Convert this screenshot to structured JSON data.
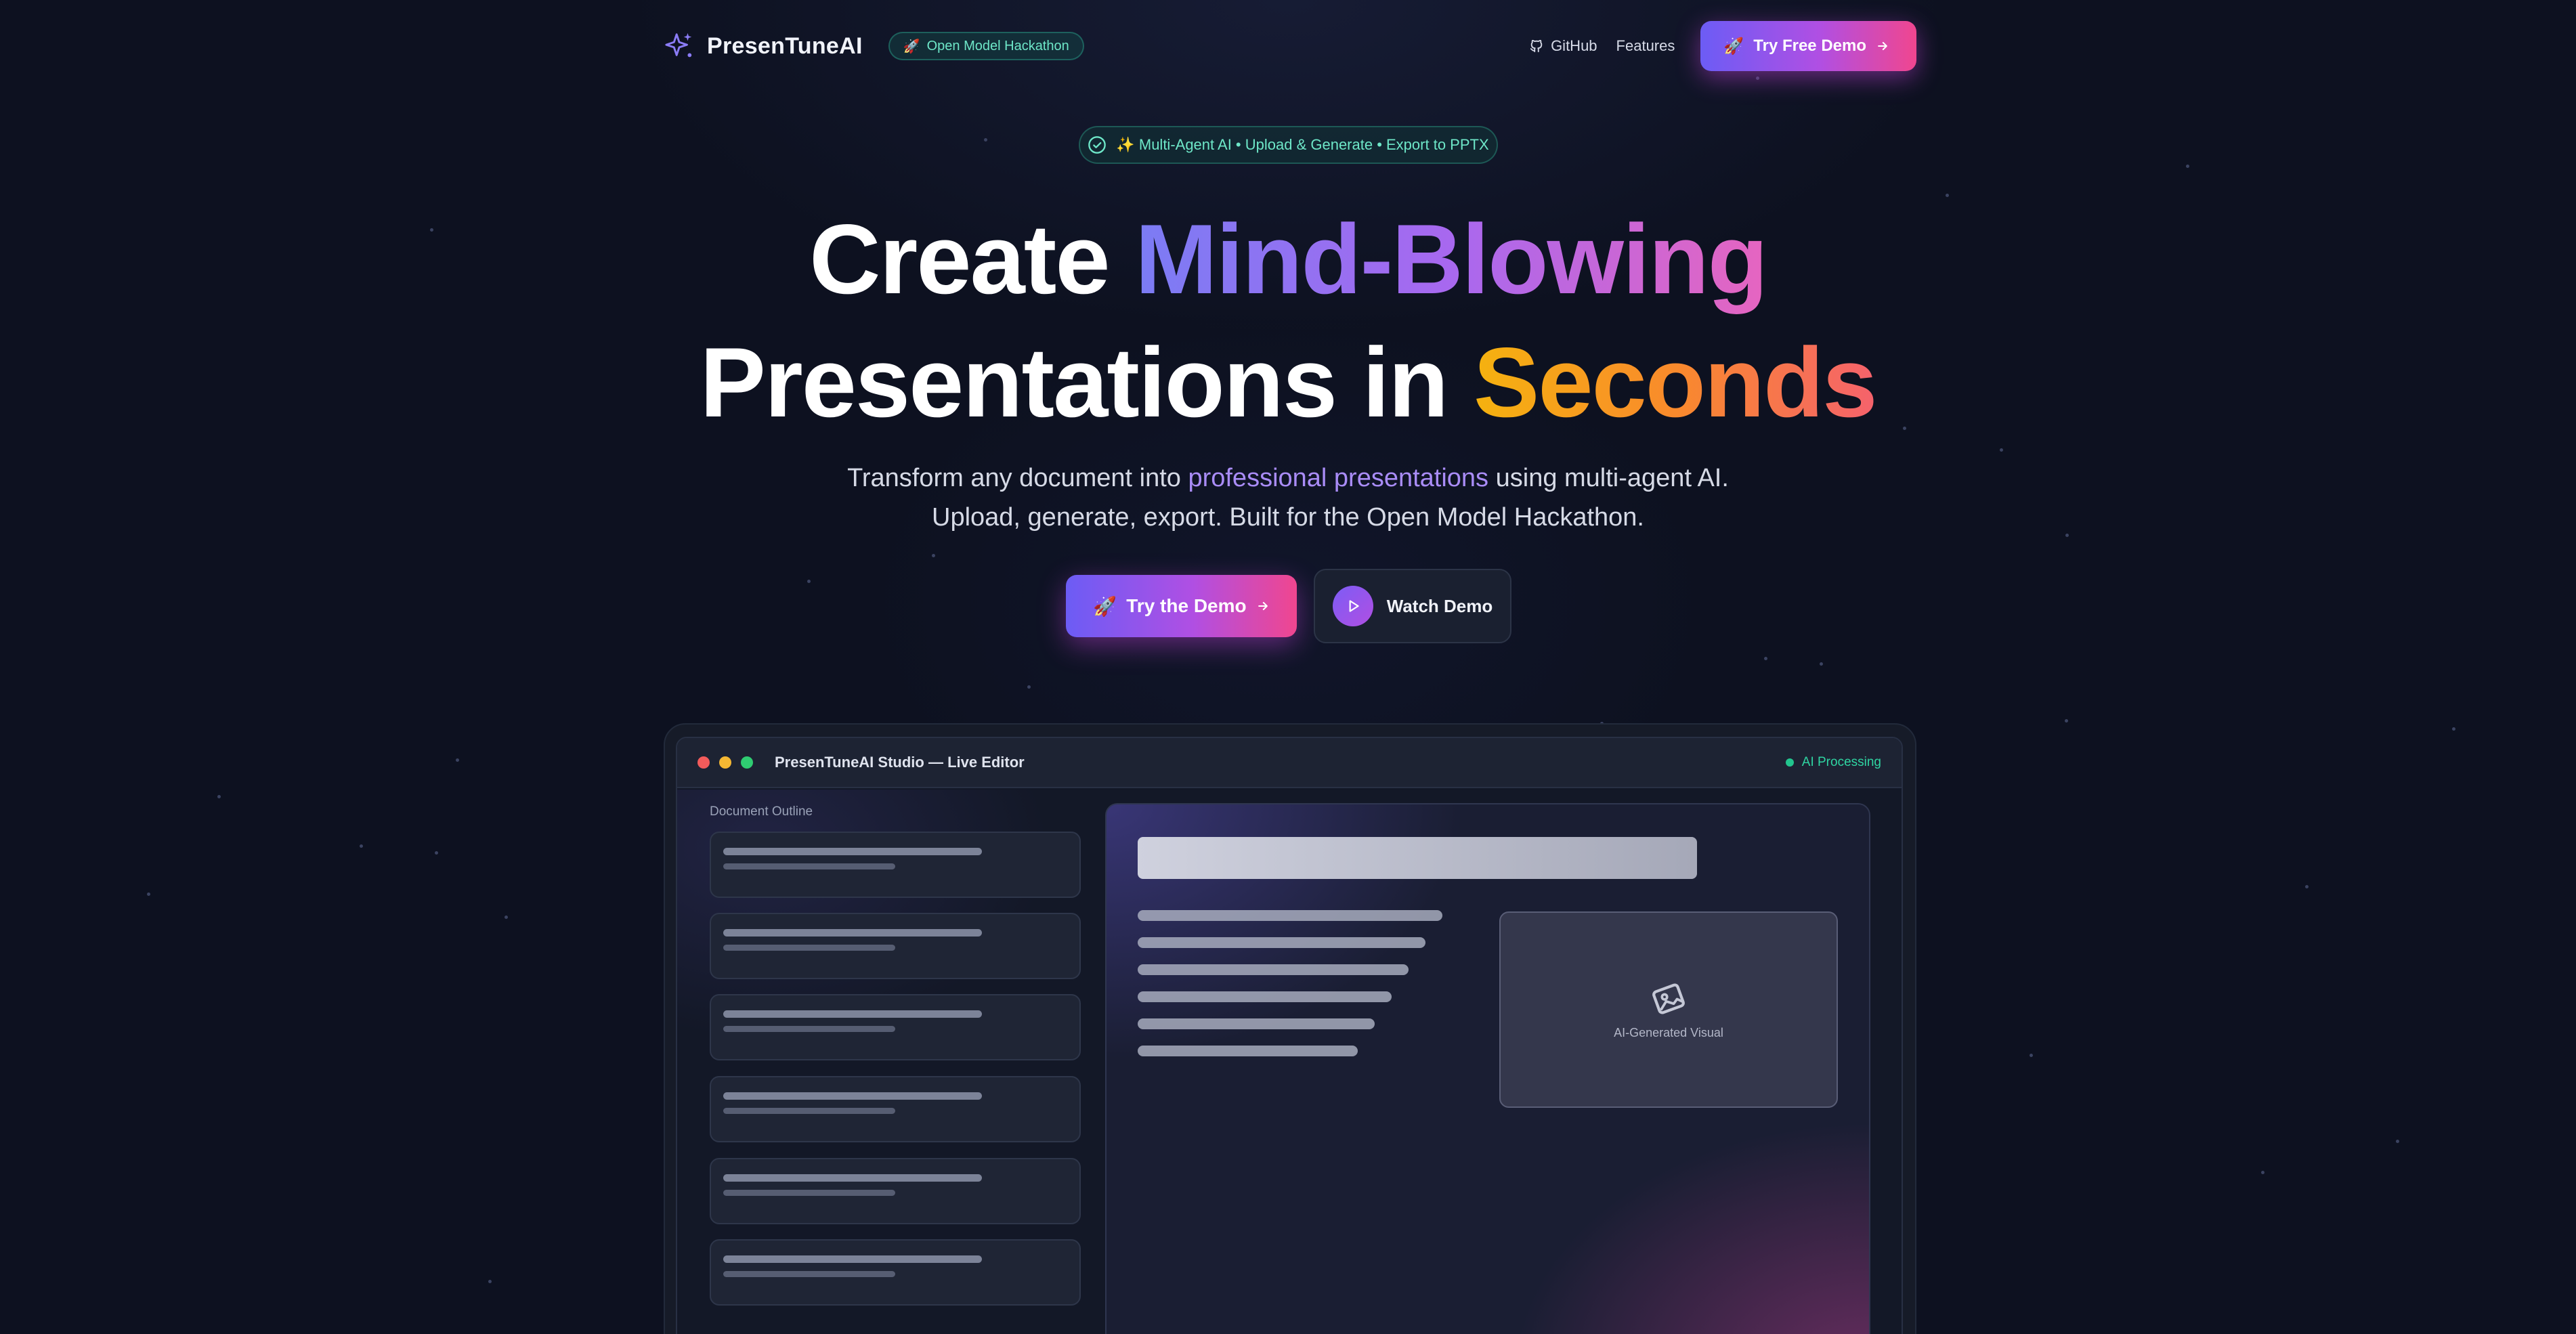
{
  "nav": {
    "brand": "PresenTuneAI",
    "badge": "Open Model Hackathon",
    "links": [
      {
        "label": "GitHub",
        "icon": "github-icon"
      },
      {
        "label": "Features"
      }
    ],
    "cta": "Try Free Demo"
  },
  "hero": {
    "pill": "✨ Multi-Agent AI • Upload & Generate • Export to PPTX",
    "title_line1_plain": "Create ",
    "title_line1_gradient": "Mind-Blowing",
    "title_line2_plain": "Presentations in ",
    "title_line2_gradient": "Seconds",
    "subtitle_before": "Transform any document into ",
    "subtitle_highlight": "professional presentations",
    "subtitle_after": " using multi-agent AI.",
    "subtitle_line2": "Upload, generate, export. Built for the Open Model Hackathon.",
    "primary_button": "Try the Demo",
    "secondary_button": "Watch Demo"
  },
  "editor": {
    "window_title": "PresenTuneAI Studio — Live Editor",
    "status": "AI Processing",
    "outline_label": "Document Outline",
    "outline_card_count_shown": 6,
    "visual_label": "AI-Generated Visual"
  },
  "colors": {
    "background": "#0d1120",
    "accent_gradient_start": "#6c5cf5",
    "accent_gradient_end": "#f0468f",
    "success": "#22c58e",
    "badge_text": "#6ee7c8"
  }
}
